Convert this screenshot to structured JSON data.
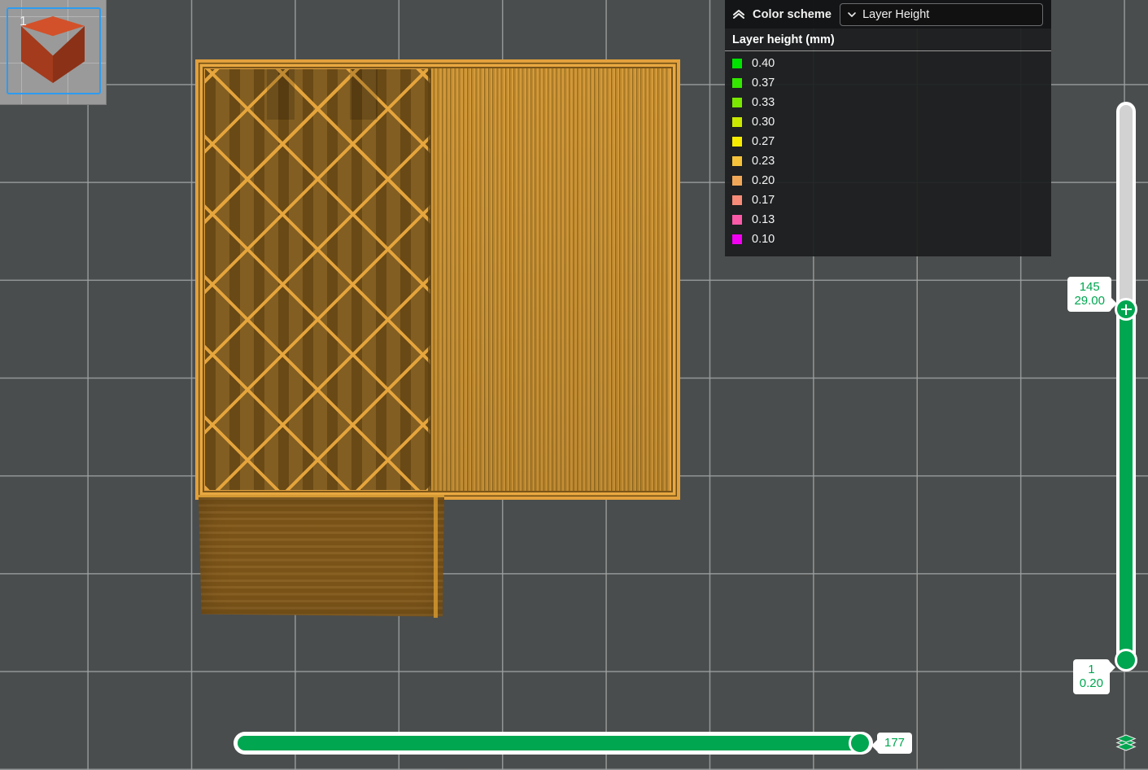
{
  "app": {
    "background_color": "#4a4d4d",
    "grid_line_color": "#a0a3a3",
    "accent_color": "#00a650"
  },
  "thumbnail": {
    "object_index": "1",
    "selection_color": "#2d9cf0",
    "cube_top_color": "#d2512a",
    "cube_left_color": "#a33b1c",
    "cube_right_color": "#8b3117"
  },
  "legend": {
    "collapse_icon": "chevrons-up-icon",
    "title": "Color scheme",
    "dropdown_icon": "chevron-down-icon",
    "dropdown_value": "Layer Height",
    "subtitle": "Layer height (mm)",
    "entries": [
      {
        "color": "#00e300",
        "label": "0.40"
      },
      {
        "color": "#35e800",
        "label": "0.37"
      },
      {
        "color": "#7ae800",
        "label": "0.33"
      },
      {
        "color": "#cbe800",
        "label": "0.30"
      },
      {
        "color": "#f7ec00",
        "label": "0.27"
      },
      {
        "color": "#f5c23a",
        "label": "0.23"
      },
      {
        "color": "#f0a858",
        "label": "0.20"
      },
      {
        "color": "#f58b78",
        "label": "0.17"
      },
      {
        "color": "#fa5aa8",
        "label": "0.13"
      },
      {
        "color": "#f200f2",
        "label": "0.10"
      }
    ]
  },
  "vertical_slider": {
    "name": "layer-range-slider",
    "upper_handle": {
      "icon": "plus-icon",
      "layer": "145",
      "height": "29.00"
    },
    "lower_handle": {
      "layer": "1",
      "height": "0.20"
    }
  },
  "horizontal_slider": {
    "name": "move-step-slider",
    "value": "177"
  },
  "layers_button": {
    "icon": "layers-icon",
    "color": "#00a650"
  },
  "model": {
    "infill_line_color": "#e8a73d",
    "infill_base_color": "#7d5719",
    "solid_fill_color": "#c9912f",
    "wall_color": "#83591a"
  }
}
